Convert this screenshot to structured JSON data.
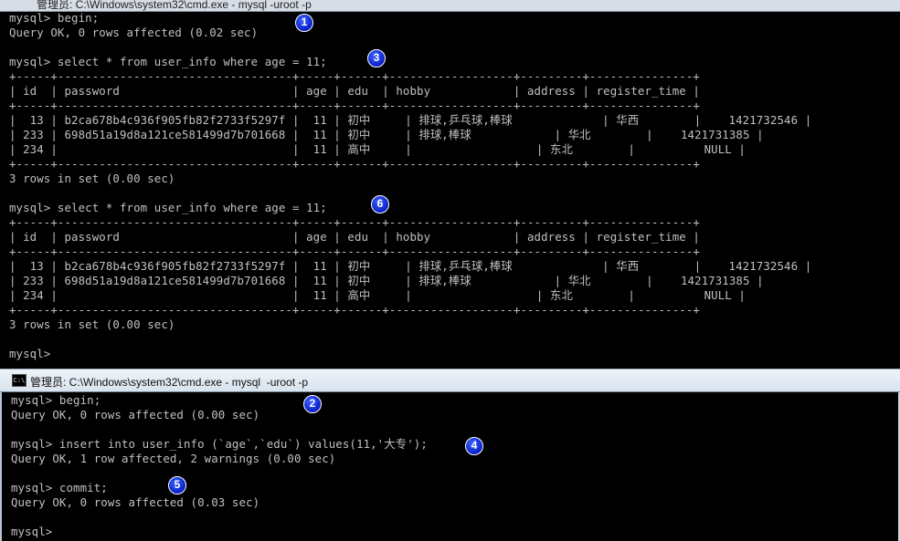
{
  "top_window": {
    "title_partial": "管理员: C:\\Windows\\system32\\cmd.exe - mysql  -uroot -p",
    "lines": [
      "mysql> begin;",
      "Query OK, 0 rows affected (0.02 sec)",
      "",
      "mysql> select * from user_info where age = 11;",
      "+-----+----------------------------------+-----+------+------------------+---------+---------------+",
      "| id  | password                         | age | edu  | hobby            | address | register_time |",
      "+-----+----------------------------------+-----+------+------------------+---------+---------------+",
      "|  13 | b2ca678b4c936f905fb82f2733f5297f |  11 | 初中     | 排球,乒乓球,棒球             | 华西        |    1421732546 |",
      "| 233 | 698d51a19d8a121ce581499d7b701668 |  11 | 初中     | 排球,棒球            | 华北        |    1421731385 |",
      "| 234 |                                  |  11 | 高中     |                  | 东北        |          NULL |",
      "+-----+----------------------------------+-----+------+------------------+---------+---------------+",
      "3 rows in set (0.00 sec)",
      "",
      "mysql> select * from user_info where age = 11;",
      "+-----+----------------------------------+-----+------+------------------+---------+---------------+",
      "| id  | password                         | age | edu  | hobby            | address | register_time |",
      "+-----+----------------------------------+-----+------+------------------+---------+---------------+",
      "|  13 | b2ca678b4c936f905fb82f2733f5297f |  11 | 初中     | 排球,乒乓球,棒球             | 华西        |    1421732546 |",
      "| 233 | 698d51a19d8a121ce581499d7b701668 |  11 | 初中     | 排球,棒球            | 华北        |    1421731385 |",
      "| 234 |                                  |  11 | 高中     |                  | 东北        |          NULL |",
      "+-----+----------------------------------+-----+------+------------------+---------+---------------+",
      "3 rows in set (0.00 sec)",
      "",
      "mysql>"
    ]
  },
  "bottom_window": {
    "title": "管理员: C:\\Windows\\system32\\cmd.exe - mysql  -uroot -p",
    "icon_text": "C:\\",
    "lines": [
      "mysql> begin;",
      "Query OK, 0 rows affected (0.00 sec)",
      "",
      "mysql> insert into user_info (`age`,`edu`) values(11,'大专');",
      "Query OK, 1 row affected, 2 warnings (0.00 sec)",
      "",
      "mysql> commit;",
      "Query OK, 0 rows affected (0.03 sec)",
      "",
      "mysql>"
    ]
  },
  "markers": [
    "1",
    "2",
    "3",
    "4",
    "5",
    "6"
  ],
  "colors": {
    "console_bg": "#000000",
    "console_text": "#c0c0c0",
    "marker_fill": "#1a3cf0"
  }
}
